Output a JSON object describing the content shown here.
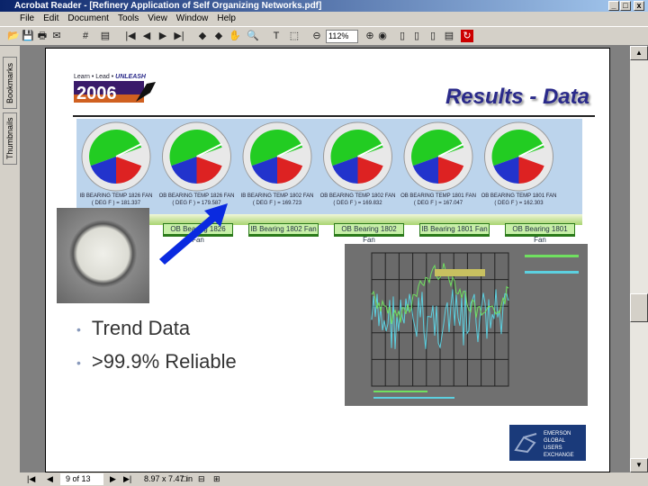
{
  "window": {
    "title": "Acrobat Reader - [Refinery Application of Self Organizing Networks.pdf]"
  },
  "menu": [
    "File",
    "Edit",
    "Document",
    "Tools",
    "View",
    "Window",
    "Help"
  ],
  "toolbar": {
    "zoom": "112%",
    "icons": [
      "open-icon",
      "save-icon",
      "print-icon",
      "email-icon",
      "find-icon",
      "bookmark-icon",
      "first-page-icon",
      "prev-page-icon",
      "next-page-icon",
      "last-page-icon",
      "back-icon",
      "forward-icon",
      "hand-tool-icon",
      "zoom-tool-icon",
      "text-select-icon",
      "snapshot-icon",
      "zoom-out-icon",
      "zoom-in-icon",
      "actual-size-icon",
      "fit-page-icon",
      "fit-width-icon",
      "reflow-icon",
      "rotate-icon",
      "adobe-icon"
    ]
  },
  "sidetabs": [
    "Bookmarks",
    "Thumbnails"
  ],
  "status": {
    "page": "9 of 13",
    "size": "8.97 x 7.47 in"
  },
  "slide": {
    "logo": {
      "tagline": "Learn • Lead • UNLEASH",
      "year": "2006"
    },
    "title": "Results - Data",
    "gauges": [
      {
        "label": "IB BEARING TEMP 1826 FAN",
        "value": "( DEG F ) = 181.337"
      },
      {
        "label": "OB BEARING TEMP 1826 FAN",
        "value": "( DEG F ) = 179.587"
      },
      {
        "label": "IB BEARING TEMP 1802 FAN",
        "value": "( DEG F ) = 169.723"
      },
      {
        "label": "OB BEARING TEMP 1802 FAN",
        "value": "( DEG F ) = 169.832"
      },
      {
        "label": "OB BEARING TEMP 1801 FAN",
        "value": "( DEG F ) = 167.047"
      },
      {
        "label": "OB BEARING TEMP 1801 FAN",
        "value": "( DEG F ) = 162.303"
      }
    ],
    "fan_buttons": [
      "OB Bearing 1826 Fan",
      "IB Bearing 1802 Fan",
      "OB Bearing 1802 Fan",
      "IB Bearing 1801 Fan",
      "OB Bearing 1801 Fan"
    ],
    "bullets": [
      "Trend Data",
      ">99.9% Reliable"
    ],
    "emerson": [
      "EMERSON",
      "GLOBAL",
      "USERS",
      "EXCHANGE"
    ],
    "colors": {
      "title": "#2a2a8a",
      "gauge_green": "#22cc22",
      "gauge_blue": "#2233cc",
      "gauge_red": "#dd2222",
      "arrow": "#0a2ae0"
    }
  }
}
